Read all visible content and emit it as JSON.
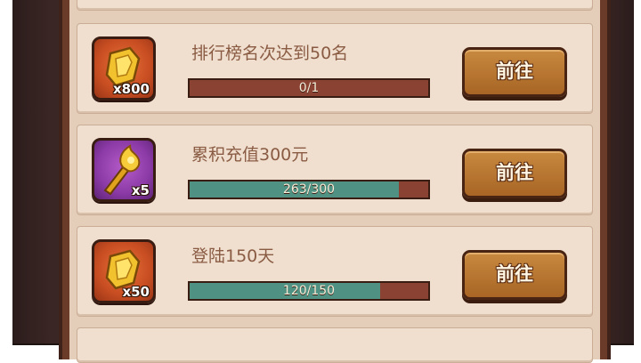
{
  "tasks": [
    {
      "name": "排行榜名次达到50名",
      "reward_qty": "x800",
      "reward_icon": "token-icon",
      "progress_text": "0/1",
      "progress": 0,
      "button": "前往"
    },
    {
      "name": "累积充值300元",
      "reward_qty": "x5",
      "reward_icon": "torch-icon",
      "progress_text": "263/300",
      "progress": 0.877,
      "button": "前往"
    },
    {
      "name": "登陆150天",
      "reward_qty": "x50",
      "reward_icon": "token-icon",
      "progress_text": "120/150",
      "progress": 0.8,
      "button": "前往"
    }
  ],
  "colors": {
    "progress_fill": "#4f9283",
    "progress_track": "#8a4233",
    "button": "#b87532"
  }
}
